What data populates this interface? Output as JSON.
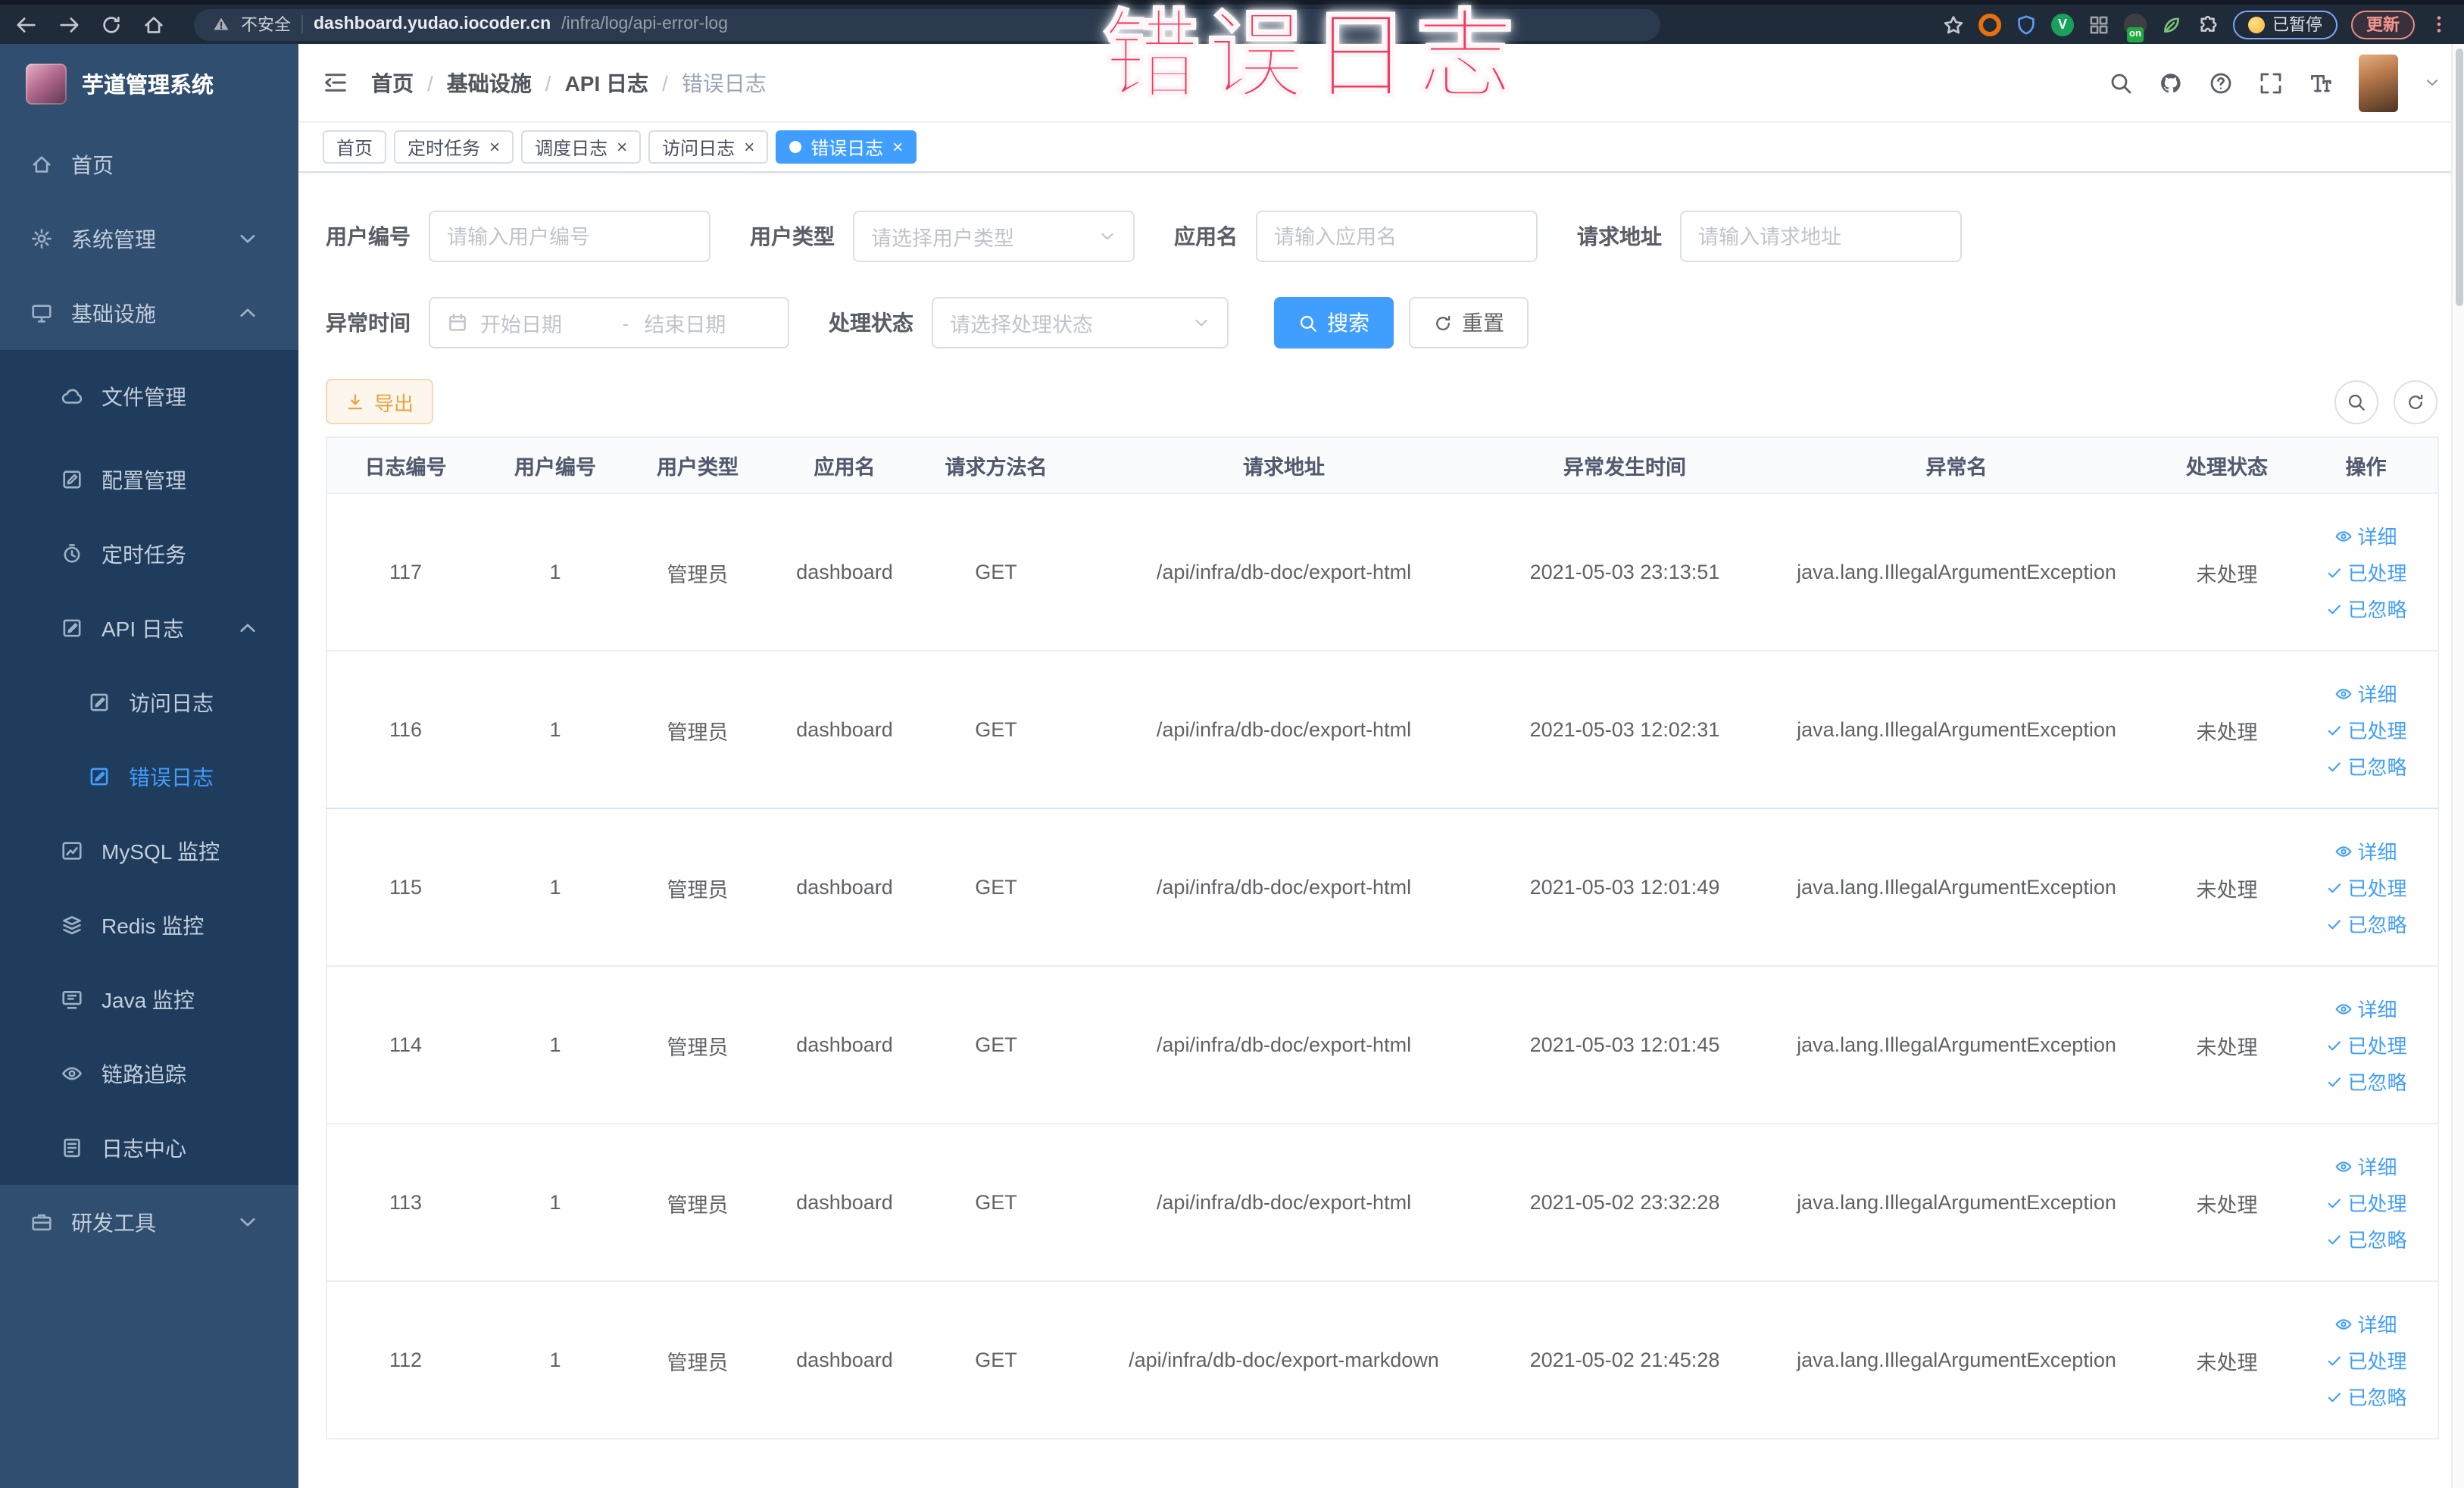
{
  "browser": {
    "nav_icons": [
      "back-icon",
      "forward-icon",
      "reload-icon",
      "home-icon"
    ],
    "security_text": "不安全",
    "url_host": "dashboard.yudao.iocoder.cn",
    "url_path": "/infra/log/api-error-log",
    "bookmark_icon": "star-icon",
    "extensions": [
      {
        "name": "ext-orange-ring-icon",
        "cls": "st-ring",
        "color": "#e8710a"
      },
      {
        "name": "ext-shield-icon",
        "cls": "st-icon",
        "color": "#5b9cf8",
        "icon": "shield-icon"
      },
      {
        "name": "ext-green-v-icon",
        "cls": "st-solid",
        "color": "#18a05c",
        "glyph": "V"
      },
      {
        "name": "ext-grid-icon",
        "cls": "st-icon",
        "color": "#9aa0a6",
        "icon": "grid-icon"
      },
      {
        "name": "ext-dark-on-icon",
        "cls": "st-solid",
        "color": "#3c4043",
        "badge": "on"
      },
      {
        "name": "ext-leaf-icon",
        "cls": "st-icon",
        "color": "#7cc576",
        "icon": "leaf-icon"
      },
      {
        "name": "ext-puzzle-icon",
        "cls": "st-icon",
        "color": "#c7ccd3",
        "icon": "puzzle-icon"
      }
    ],
    "paused_chip": {
      "label": "已暂停"
    },
    "update_chip": {
      "label": "更新"
    },
    "menu_icon": "dots-vertical-icon"
  },
  "overlay": {
    "text": "错误日志",
    "color": "#f23a5f"
  },
  "sidebar": {
    "title": "芋道管理系统",
    "items": [
      {
        "label": "首页",
        "icon": "home-icon",
        "cls": "lvl0"
      },
      {
        "label": "系统管理",
        "icon": "gear-icon",
        "cls": "lvl0",
        "chevron": "chevron-down-icon"
      },
      {
        "label": "基础设施",
        "icon": "monitor-icon",
        "cls": "lvl0",
        "chevron": "chevron-up-icon"
      },
      {
        "label": "文件管理",
        "icon": "cloud-icon",
        "cls": "lvl1 dark first-dark"
      },
      {
        "label": "配置管理",
        "icon": "edit-square-icon",
        "cls": "lvl1 dark"
      },
      {
        "label": "定时任务",
        "icon": "clock-icon",
        "cls": "lvl1 dark"
      },
      {
        "label": "API 日志",
        "icon": "doc-edit-icon",
        "cls": "lvl1 dark",
        "chevron": "chevron-up-icon"
      },
      {
        "label": "访问日志",
        "icon": "doc-edit-icon",
        "cls": "lvl2 dark"
      },
      {
        "label": "错误日志",
        "icon": "doc-edit-icon",
        "cls": "lvl2 dark active"
      },
      {
        "label": "MySQL 监控",
        "icon": "chart-icon",
        "cls": "lvl1 dark"
      },
      {
        "label": "Redis 监控",
        "icon": "layers-icon",
        "cls": "lvl1 dark"
      },
      {
        "label": "Java 监控",
        "icon": "java-monitor-icon",
        "cls": "lvl1 dark"
      },
      {
        "label": "链路追踪",
        "icon": "eye-icon",
        "cls": "lvl1 dark"
      },
      {
        "label": "日志中心",
        "icon": "doc-log-icon",
        "cls": "lvl1 dark"
      },
      {
        "label": "研发工具",
        "icon": "briefcase-icon",
        "cls": "lvl0",
        "chevron": "chevron-down-icon"
      }
    ]
  },
  "header": {
    "fold_icon": "menu-fold-icon",
    "breadcrumb": {
      "items": [
        "首页",
        "基础设施",
        "API 日志",
        "错误日志"
      ],
      "separator": "/"
    },
    "action_icons": [
      "search-icon",
      "github-icon",
      "help-icon",
      "fullscreen-icon",
      "fontsize-icon"
    ],
    "caret_icon": "chevron-down-icon"
  },
  "tabs": {
    "close_glyph": "×",
    "items": [
      {
        "label": "首页",
        "cls": ""
      },
      {
        "label": "定时任务",
        "closable": true,
        "cls": ""
      },
      {
        "label": "调度日志",
        "closable": true,
        "cls": ""
      },
      {
        "label": "访问日志",
        "closable": true,
        "cls": ""
      },
      {
        "label": "错误日志",
        "closable": true,
        "dot": true,
        "cls": "active"
      }
    ]
  },
  "filters": {
    "user_id": {
      "label": "用户编号",
      "placeholder": "请输入用户编号"
    },
    "user_type": {
      "label": "用户类型",
      "placeholder": "请选择用户类型"
    },
    "app_name": {
      "label": "应用名",
      "placeholder": "请输入应用名"
    },
    "request_url": {
      "label": "请求地址",
      "placeholder": "请输入请求地址"
    },
    "exception_time": {
      "label": "异常时间",
      "start_placeholder": "开始日期",
      "separator": "-",
      "end_placeholder": "结束日期"
    },
    "process_status": {
      "label": "处理状态",
      "placeholder": "请选择处理状态"
    },
    "search_label": "搜索",
    "reset_label": "重置"
  },
  "toolbar": {
    "export_label": "导出",
    "export_icon": "download-icon",
    "circle_buttons": [
      {
        "name": "search-toggle-button",
        "icon": "search-icon"
      },
      {
        "name": "refresh-button",
        "icon": "refresh-icon"
      }
    ]
  },
  "table": {
    "columns": [
      "日志编号",
      "用户编号",
      "用户类型",
      "应用名",
      "请求方法名",
      "请求地址",
      "异常发生时间",
      "异常名",
      "处理状态",
      "操作"
    ],
    "row_actions": [
      {
        "label": "详细",
        "icon": "eye-icon"
      },
      {
        "label": "已处理",
        "icon": "check-icon"
      },
      {
        "label": "已忽略",
        "icon": "check-icon"
      }
    ],
    "rows": [
      {
        "id": "117",
        "user_id": "1",
        "user_type": "管理员",
        "app": "dashboard",
        "method": "GET",
        "url": "/api/infra/db-doc/export-html",
        "time": "2021-05-03 23:13:51",
        "exception": "java.lang.IllegalArgumentException",
        "status": "未处理",
        "cls": ""
      },
      {
        "id": "116",
        "user_id": "1",
        "user_type": "管理员",
        "app": "dashboard",
        "method": "GET",
        "url": "/api/infra/db-doc/export-html",
        "time": "2021-05-03 12:02:31",
        "exception": "java.lang.IllegalArgumentException",
        "status": "未处理",
        "cls": "row-hl"
      },
      {
        "id": "115",
        "user_id": "1",
        "user_type": "管理员",
        "app": "dashboard",
        "method": "GET",
        "url": "/api/infra/db-doc/export-html",
        "time": "2021-05-03 12:01:49",
        "exception": "java.lang.IllegalArgumentException",
        "status": "未处理",
        "cls": ""
      },
      {
        "id": "114",
        "user_id": "1",
        "user_type": "管理员",
        "app": "dashboard",
        "method": "GET",
        "url": "/api/infra/db-doc/export-html",
        "time": "2021-05-03 12:01:45",
        "exception": "java.lang.IllegalArgumentException",
        "status": "未处理",
        "cls": ""
      },
      {
        "id": "113",
        "user_id": "1",
        "user_type": "管理员",
        "app": "dashboard",
        "method": "GET",
        "url": "/api/infra/db-doc/export-html",
        "time": "2021-05-02 23:32:28",
        "exception": "java.lang.IllegalArgumentException",
        "status": "未处理",
        "cls": ""
      },
      {
        "id": "112",
        "user_id": "1",
        "user_type": "管理员",
        "app": "dashboard",
        "method": "GET",
        "url": "/api/infra/db-doc/export-markdown",
        "time": "2021-05-02 21:45:28",
        "exception": "java.lang.IllegalArgumentException",
        "status": "未处理",
        "cls": ""
      }
    ]
  }
}
